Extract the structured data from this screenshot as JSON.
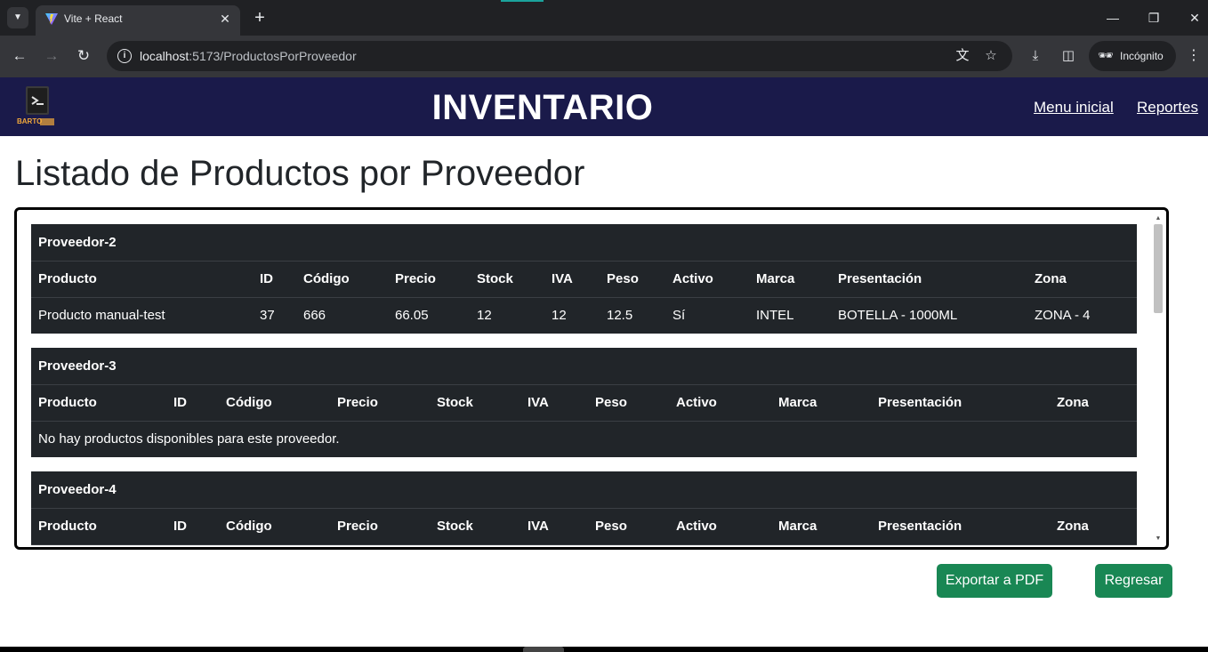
{
  "browser": {
    "tab_title": "Vite + React",
    "url_host": "localhost",
    "url_path": ":5173/ProductosPorProveedor",
    "incognito_label": "Incógnito",
    "accent_color": "#1ba39c"
  },
  "header": {
    "title": "INVENTARIO",
    "logo_text": "BARTO",
    "nav": [
      {
        "label": "Menu inicial"
      },
      {
        "label": "Reportes"
      }
    ],
    "bg_color": "#1a1a4a"
  },
  "main": {
    "heading": "Listado de Productos por Proveedor",
    "columns": [
      "Producto",
      "ID",
      "Código",
      "Precio",
      "Stock",
      "IVA",
      "Peso",
      "Activo",
      "Marca",
      "Presentación",
      "Zona"
    ],
    "providers": [
      {
        "name": "Proveedor-2",
        "rows": [
          [
            "Producto manual-test",
            "37",
            "666",
            "66.05",
            "12",
            "12",
            "12.5",
            "Sí",
            "INTEL",
            "BOTELLA - 1000ML",
            "ZONA - 4"
          ]
        ]
      },
      {
        "name": "Proveedor-3",
        "empty_message": "No hay productos disponibles para este proveedor."
      },
      {
        "name": "Proveedor-4",
        "rows": []
      }
    ]
  },
  "actions": {
    "export_label": "Exportar a PDF",
    "back_label": "Regresar",
    "button_color": "#198754"
  }
}
